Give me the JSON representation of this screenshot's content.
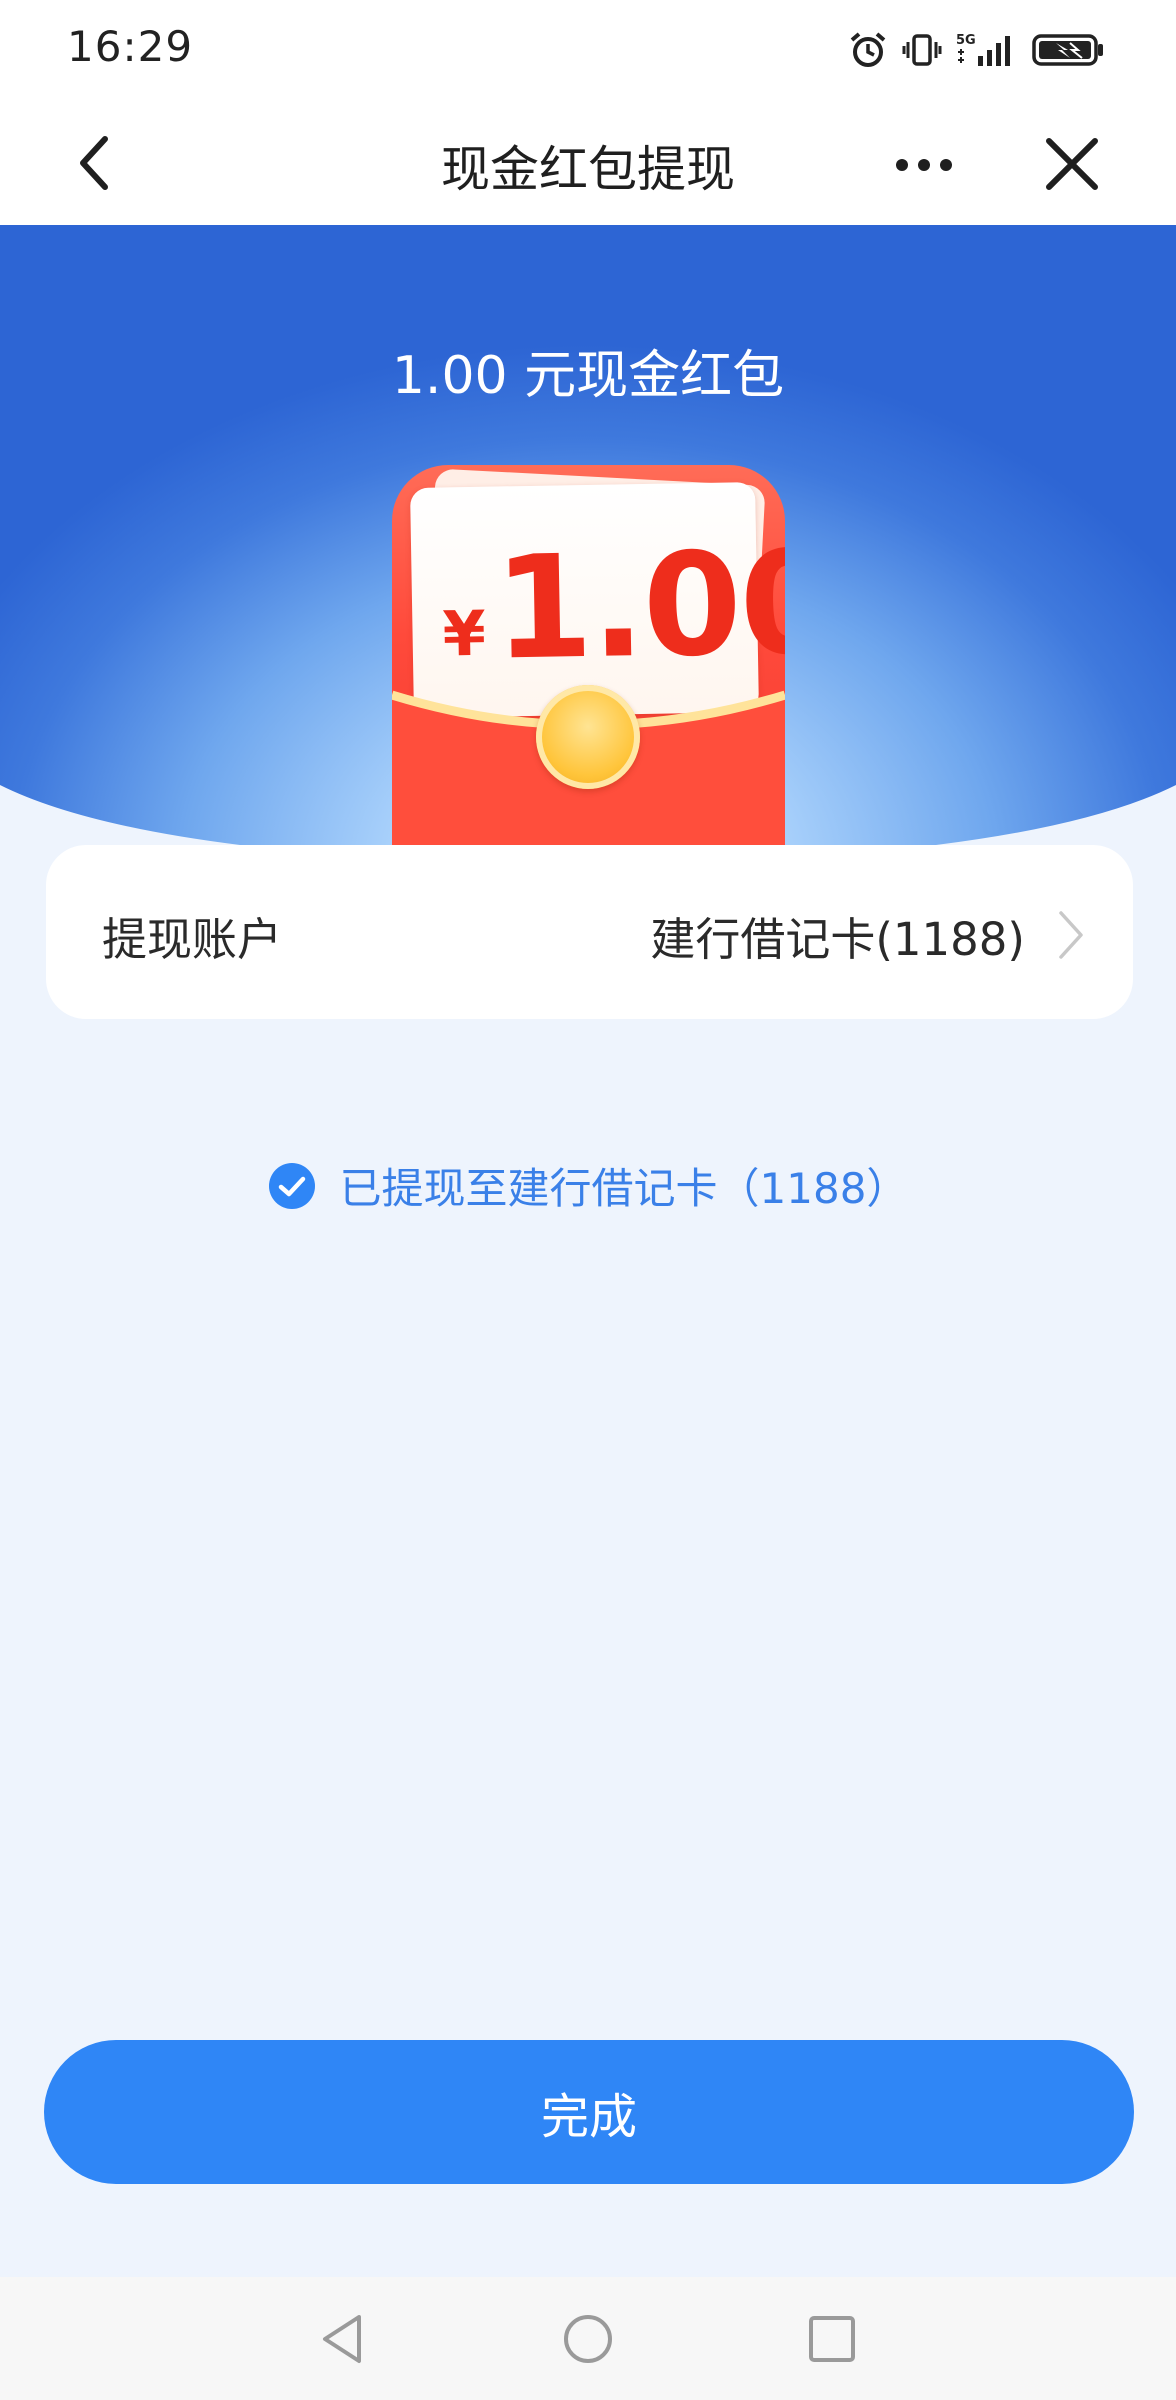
{
  "status_bar": {
    "time": "16:29",
    "icons": [
      "alarm-icon",
      "vibrate-icon",
      "5g-signal-icon",
      "battery-charging-icon"
    ],
    "network_label": "5G"
  },
  "nav": {
    "title": "现金红包提现",
    "back_icon": "chevron-left-icon",
    "more_icon": "more-horizontal-icon",
    "close_icon": "close-icon"
  },
  "hero": {
    "title": "1.00 元现金红包",
    "envelope_currency": "¥",
    "envelope_amount": "1.00"
  },
  "account": {
    "label": "提现账户",
    "value": "建行借记卡(1188)"
  },
  "status": {
    "message": "已提现至建行借记卡（1188）"
  },
  "actions": {
    "done_label": "完成"
  },
  "colors": {
    "primary_blue": "#2f86f6",
    "status_text_blue": "#3a80e8",
    "envelope_red": "#ff4a3b",
    "amount_red": "#ee2d1c",
    "page_background": "#eef4fd"
  }
}
